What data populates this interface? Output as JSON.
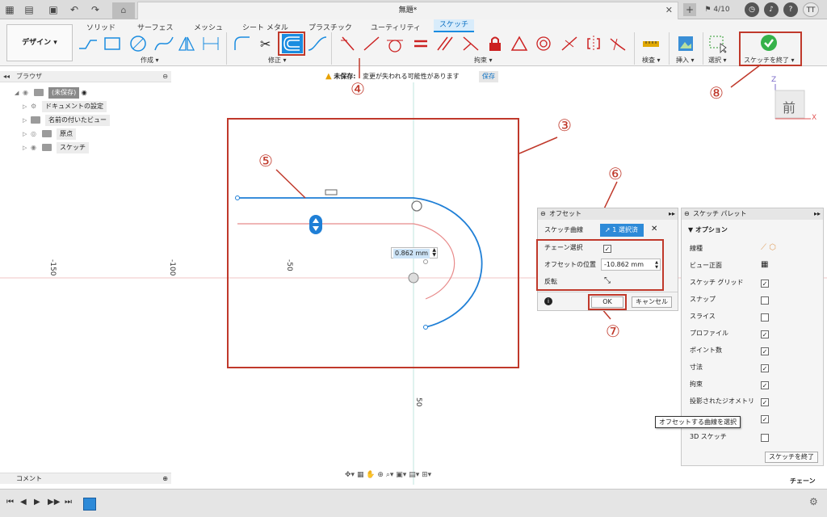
{
  "titlebar": {
    "doc_title": "無題*",
    "jobs": "4/10",
    "user_initials": "TT"
  },
  "toolbar": {
    "workspace": "デザイン",
    "tabs": [
      "ソリッド",
      "サーフェス",
      "メッシュ",
      "シート メタル",
      "プラスチック",
      "ユーティリティ"
    ],
    "active_tab": "スケッチ",
    "groups": {
      "create": "作成",
      "modify": "修正",
      "constraint": "拘束",
      "inspect": "検査",
      "insert": "挿入",
      "select": "選択",
      "finish": "スケッチを終了"
    }
  },
  "browser": {
    "header": "ブラウザ",
    "items": [
      {
        "label": "(未保存)"
      },
      {
        "label": "ドキュメントの設定"
      },
      {
        "label": "名前の付いたビュー"
      },
      {
        "label": "原点"
      },
      {
        "label": "スケッチ"
      }
    ]
  },
  "unsaved": {
    "label": "未保存:",
    "message": "変更が失われる可能性があります",
    "save": "保存"
  },
  "viewcube": {
    "face": "前",
    "axis_z": "Z",
    "axis_x": "X"
  },
  "axis_labels": [
    "-150",
    "-100",
    "-50",
    "50"
  ],
  "dimension": {
    "value": "0.862 mm"
  },
  "offset_dialog": {
    "title": "オフセット",
    "curve_label": "スケッチ曲線",
    "curve_button": "1 選択済",
    "chain_label": "チェーン選択",
    "chain_checked": true,
    "position_label": "オフセットの位置",
    "position_value": "-10.862 mm",
    "flip_label": "反転",
    "ok": "OK",
    "cancel": "キャンセル"
  },
  "palette": {
    "title": "スケッチ パレット",
    "options_header": "オプション",
    "rows": [
      {
        "label": "線種",
        "type": "icons"
      },
      {
        "label": "ビュー正面",
        "type": "icon"
      },
      {
        "label": "スケッチ グリッド",
        "checked": true
      },
      {
        "label": "スナップ",
        "checked": false
      },
      {
        "label": "スライス",
        "checked": false
      },
      {
        "label": "プロファイル",
        "checked": true
      },
      {
        "label": "ポイント数",
        "checked": true
      },
      {
        "label": "寸法",
        "checked": true
      },
      {
        "label": "拘束",
        "checked": true
      },
      {
        "label": "投影されたジオメトリ",
        "checked": true
      },
      {
        "label": "",
        "checked": true
      },
      {
        "label": "3D スケッチ",
        "checked": false
      }
    ],
    "finish": "スケッチを終了"
  },
  "tooltip": "オフセットする曲線を選択",
  "comment": "コメント",
  "status": "チェーン",
  "annotations": [
    "③",
    "④",
    "⑤",
    "⑥",
    "⑦",
    "⑧"
  ],
  "colors": {
    "accent": "#1a8ce0",
    "annotation": "#c0392b",
    "curve": "#1f7fd6",
    "offset_curve": "#e88a8a"
  }
}
